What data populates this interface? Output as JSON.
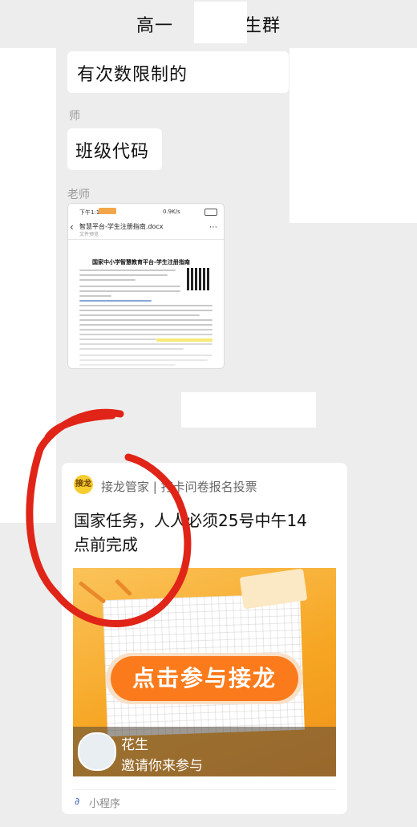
{
  "header": {
    "title_left": "高一",
    "title_right": "生群"
  },
  "messages": [
    {
      "sender": "",
      "text": "有次数限制的"
    },
    {
      "sender": "师",
      "text": "班级代码"
    }
  ],
  "file_message": {
    "sender": "老师",
    "status_time": "下午1:14",
    "status_net": "0.9K/s",
    "file_name": "智慧平台-学生注册指南.docx",
    "file_preview_label": "文件预览",
    "doc_title": "国家中小学智慧教育平台-学生注册指南"
  },
  "share_card": {
    "app_badge": "接龙",
    "app_name": "接龙管家 | 打卡问卷报名投票",
    "title": "国家任务，人人必须25号中午14点前完成",
    "title_line1": "国家任务，人人必须25号中午14",
    "title_line2": "点前完成",
    "join_button": "点击参与接龙",
    "inviter_name": "花生",
    "invite_text": "邀请你来参与",
    "footer_label": "小程序"
  },
  "colors": {
    "page_bg": "#ededed",
    "card_orange": "#f6a623",
    "button_orange": "#fb7b1c",
    "annotation_red": "#e02418"
  },
  "icons": [
    "back-arrow-icon",
    "qr-code-icon",
    "mini-program-icon",
    "pencil-icon",
    "book-icon"
  ]
}
